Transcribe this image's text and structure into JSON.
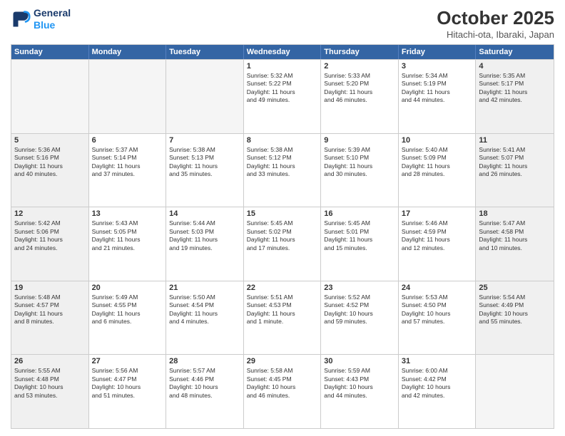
{
  "header": {
    "logo_line1": "General",
    "logo_line2": "Blue",
    "title": "October 2025",
    "subtitle": "Hitachi-ota, Ibaraki, Japan"
  },
  "weekdays": [
    "Sunday",
    "Monday",
    "Tuesday",
    "Wednesday",
    "Thursday",
    "Friday",
    "Saturday"
  ],
  "rows": [
    [
      {
        "day": "",
        "text": "",
        "empty": true
      },
      {
        "day": "",
        "text": "",
        "empty": true
      },
      {
        "day": "",
        "text": "",
        "empty": true
      },
      {
        "day": "1",
        "text": "Sunrise: 5:32 AM\nSunset: 5:22 PM\nDaylight: 11 hours\nand 49 minutes.",
        "empty": false
      },
      {
        "day": "2",
        "text": "Sunrise: 5:33 AM\nSunset: 5:20 PM\nDaylight: 11 hours\nand 46 minutes.",
        "empty": false
      },
      {
        "day": "3",
        "text": "Sunrise: 5:34 AM\nSunset: 5:19 PM\nDaylight: 11 hours\nand 44 minutes.",
        "empty": false
      },
      {
        "day": "4",
        "text": "Sunrise: 5:35 AM\nSunset: 5:17 PM\nDaylight: 11 hours\nand 42 minutes.",
        "empty": false,
        "shaded": true
      }
    ],
    [
      {
        "day": "5",
        "text": "Sunrise: 5:36 AM\nSunset: 5:16 PM\nDaylight: 11 hours\nand 40 minutes.",
        "empty": false,
        "shaded": true
      },
      {
        "day": "6",
        "text": "Sunrise: 5:37 AM\nSunset: 5:14 PM\nDaylight: 11 hours\nand 37 minutes.",
        "empty": false
      },
      {
        "day": "7",
        "text": "Sunrise: 5:38 AM\nSunset: 5:13 PM\nDaylight: 11 hours\nand 35 minutes.",
        "empty": false
      },
      {
        "day": "8",
        "text": "Sunrise: 5:38 AM\nSunset: 5:12 PM\nDaylight: 11 hours\nand 33 minutes.",
        "empty": false
      },
      {
        "day": "9",
        "text": "Sunrise: 5:39 AM\nSunset: 5:10 PM\nDaylight: 11 hours\nand 30 minutes.",
        "empty": false
      },
      {
        "day": "10",
        "text": "Sunrise: 5:40 AM\nSunset: 5:09 PM\nDaylight: 11 hours\nand 28 minutes.",
        "empty": false
      },
      {
        "day": "11",
        "text": "Sunrise: 5:41 AM\nSunset: 5:07 PM\nDaylight: 11 hours\nand 26 minutes.",
        "empty": false,
        "shaded": true
      }
    ],
    [
      {
        "day": "12",
        "text": "Sunrise: 5:42 AM\nSunset: 5:06 PM\nDaylight: 11 hours\nand 24 minutes.",
        "empty": false,
        "shaded": true
      },
      {
        "day": "13",
        "text": "Sunrise: 5:43 AM\nSunset: 5:05 PM\nDaylight: 11 hours\nand 21 minutes.",
        "empty": false
      },
      {
        "day": "14",
        "text": "Sunrise: 5:44 AM\nSunset: 5:03 PM\nDaylight: 11 hours\nand 19 minutes.",
        "empty": false
      },
      {
        "day": "15",
        "text": "Sunrise: 5:45 AM\nSunset: 5:02 PM\nDaylight: 11 hours\nand 17 minutes.",
        "empty": false
      },
      {
        "day": "16",
        "text": "Sunrise: 5:45 AM\nSunset: 5:01 PM\nDaylight: 11 hours\nand 15 minutes.",
        "empty": false
      },
      {
        "day": "17",
        "text": "Sunrise: 5:46 AM\nSunset: 4:59 PM\nDaylight: 11 hours\nand 12 minutes.",
        "empty": false
      },
      {
        "day": "18",
        "text": "Sunrise: 5:47 AM\nSunset: 4:58 PM\nDaylight: 11 hours\nand 10 minutes.",
        "empty": false,
        "shaded": true
      }
    ],
    [
      {
        "day": "19",
        "text": "Sunrise: 5:48 AM\nSunset: 4:57 PM\nDaylight: 11 hours\nand 8 minutes.",
        "empty": false,
        "shaded": true
      },
      {
        "day": "20",
        "text": "Sunrise: 5:49 AM\nSunset: 4:55 PM\nDaylight: 11 hours\nand 6 minutes.",
        "empty": false
      },
      {
        "day": "21",
        "text": "Sunrise: 5:50 AM\nSunset: 4:54 PM\nDaylight: 11 hours\nand 4 minutes.",
        "empty": false
      },
      {
        "day": "22",
        "text": "Sunrise: 5:51 AM\nSunset: 4:53 PM\nDaylight: 11 hours\nand 1 minute.",
        "empty": false
      },
      {
        "day": "23",
        "text": "Sunrise: 5:52 AM\nSunset: 4:52 PM\nDaylight: 10 hours\nand 59 minutes.",
        "empty": false
      },
      {
        "day": "24",
        "text": "Sunrise: 5:53 AM\nSunset: 4:50 PM\nDaylight: 10 hours\nand 57 minutes.",
        "empty": false
      },
      {
        "day": "25",
        "text": "Sunrise: 5:54 AM\nSunset: 4:49 PM\nDaylight: 10 hours\nand 55 minutes.",
        "empty": false,
        "shaded": true
      }
    ],
    [
      {
        "day": "26",
        "text": "Sunrise: 5:55 AM\nSunset: 4:48 PM\nDaylight: 10 hours\nand 53 minutes.",
        "empty": false,
        "shaded": true
      },
      {
        "day": "27",
        "text": "Sunrise: 5:56 AM\nSunset: 4:47 PM\nDaylight: 10 hours\nand 51 minutes.",
        "empty": false
      },
      {
        "day": "28",
        "text": "Sunrise: 5:57 AM\nSunset: 4:46 PM\nDaylight: 10 hours\nand 48 minutes.",
        "empty": false
      },
      {
        "day": "29",
        "text": "Sunrise: 5:58 AM\nSunset: 4:45 PM\nDaylight: 10 hours\nand 46 minutes.",
        "empty": false
      },
      {
        "day": "30",
        "text": "Sunrise: 5:59 AM\nSunset: 4:43 PM\nDaylight: 10 hours\nand 44 minutes.",
        "empty": false
      },
      {
        "day": "31",
        "text": "Sunrise: 6:00 AM\nSunset: 4:42 PM\nDaylight: 10 hours\nand 42 minutes.",
        "empty": false
      },
      {
        "day": "",
        "text": "",
        "empty": true,
        "shaded": true
      }
    ]
  ]
}
